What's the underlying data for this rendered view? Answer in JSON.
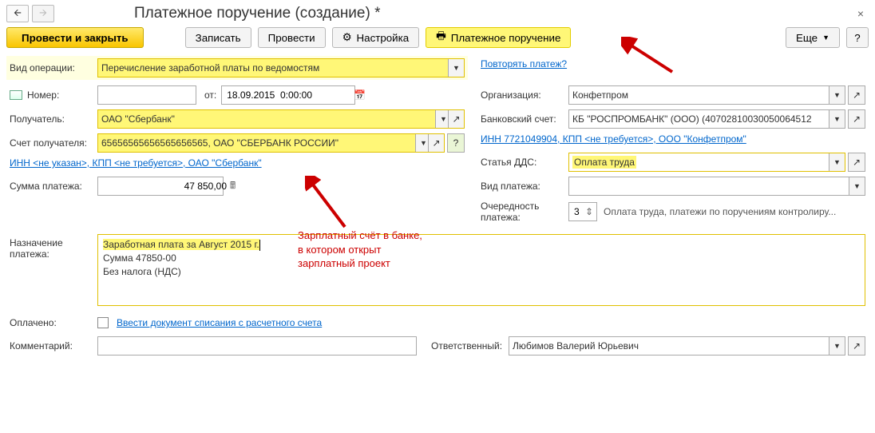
{
  "title": "Платежное поручение (создание) *",
  "toolbar": {
    "post_close": "Провести и закрыть",
    "save": "Записать",
    "post": "Провести",
    "settings": "Настройка",
    "print": "Платежное поручение",
    "more": "Еще",
    "help": "?"
  },
  "links": {
    "repeat": "Повторять платеж?",
    "inn_l": "ИНН <не указан>, КПП <не требуется>, ОАО \"Сбербанк\"",
    "inn_r": "ИНН 7721049904, КПП <не требуется>, ООО \"Конфетпром\"",
    "write_off": "Ввести документ списания с расчетного счета"
  },
  "labels": {
    "op_type": "Вид операции:",
    "number": "Номер:",
    "from": "от:",
    "recipient": "Получатель:",
    "recipient_acc": "Счет получателя:",
    "amount": "Сумма платежа:",
    "org": "Организация:",
    "bank_acc": "Банковский счет:",
    "dds": "Статья ДДС:",
    "pay_type": "Вид платежа:",
    "priority": "Очередность платежа:",
    "purpose": "Назначение платежа:",
    "paid": "Оплачено:",
    "comment": "Комментарий:",
    "responsible": "Ответственный:"
  },
  "values": {
    "op_type": "Перечисление заработной платы по ведомостям",
    "number": "",
    "date": "18.09.2015  0:00:00",
    "recipient": "ОАО \"Сбербанк\"",
    "recipient_acc": "65656565656565656565, ОАО \"СБЕРБАНК РОССИИ\"",
    "amount": "47 850,00",
    "org": "Конфетпром",
    "bank_acc": "КБ \"РОСПРОМБАНК\" (ООО) (40702810030050064512",
    "dds": "Оплата труда",
    "pay_type": "",
    "priority": "3",
    "priority_desc": "Оплата труда, платежи по поручениям контролиру...",
    "purpose_l1": "Заработная плата за Август 2015 г.",
    "purpose_l2": "Сумма 47850-00",
    "purpose_l3": "Без налога (НДС)",
    "comment": "",
    "responsible": "Любимов Валерий Юрьевич"
  },
  "annotation": {
    "l1": "Зарплатный счёт в банке,",
    "l2": "в котором открыт",
    "l3": "зарплатный проект"
  },
  "icons": {
    "back": "🡨",
    "fwd": "🡪",
    "close": "×",
    "gear": "⚙",
    "print": "🖶",
    "dd": "▼",
    "open": "↗",
    "cal": "📅",
    "calc": "🖩",
    "spin": "⇕"
  }
}
